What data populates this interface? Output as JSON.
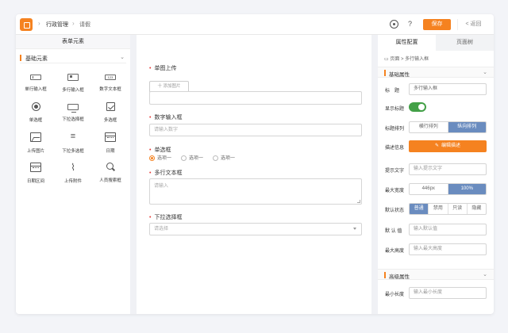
{
  "header": {
    "breadcrumb": [
      "行政管理",
      "请假"
    ],
    "save_label": "保存",
    "back_label": "< 返回",
    "settings_icon": "gear-icon",
    "help_text": "?"
  },
  "left_panel": {
    "title": "表单元素",
    "group_title": "基础元素",
    "components": [
      {
        "label": "单行输入框",
        "icon": "input-icon"
      },
      {
        "label": "多行输入框",
        "icon": "textarea-icon"
      },
      {
        "label": "数字文本框",
        "icon": "number-icon"
      },
      {
        "label": "单选框",
        "icon": "radio-icon"
      },
      {
        "label": "下拉选择框",
        "icon": "select-icon"
      },
      {
        "label": "多选框",
        "icon": "checkbox-icon"
      },
      {
        "label": "上传图片",
        "icon": "image-icon"
      },
      {
        "label": "下拉多选框",
        "icon": "multi-select-icon"
      },
      {
        "label": "日期",
        "icon": "calendar-icon"
      },
      {
        "label": "日期区间",
        "icon": "date-range-icon"
      },
      {
        "label": "上传附件",
        "icon": "paperclip-icon"
      },
      {
        "label": "人员搜索框",
        "icon": "search-icon"
      }
    ],
    "number_icon_text": "123"
  },
  "canvas": {
    "image_upload": {
      "label": "单图上传",
      "button": "十 添加图片"
    },
    "number_field": {
      "label": "数字输入框",
      "placeholder": "请输入数字"
    },
    "radio_field": {
      "label": "单选框",
      "options": [
        "选项一",
        "选项一",
        "选项一"
      ]
    },
    "textarea_field": {
      "label": "多行文本框",
      "placeholder": "请输入"
    },
    "select_field": {
      "label": "下拉选择框",
      "placeholder": "请选择"
    }
  },
  "right_panel": {
    "tabs": [
      "属性配置",
      "页面树"
    ],
    "breadcrumb": "页面 > 多行输入框",
    "basic_section": "基础属性",
    "advanced_section": "高级属性",
    "props": {
      "title_label": "标　题",
      "title_value": "多行输入框",
      "show_title_label": "显示标题",
      "title_layout_label": "标题排列",
      "title_layout_options": [
        "横行排列",
        "纵向排列"
      ],
      "desc_label": "描述信息",
      "edit_desc_button": "编辑描述",
      "hint_label": "提示文字",
      "hint_placeholder": "输入提示文字",
      "max_width_label": "最大宽度",
      "max_width_options": [
        "446px",
        "100%"
      ],
      "default_state_label": "默认状态",
      "state_options": [
        "普通",
        "禁用",
        "只读",
        "隐藏"
      ],
      "default_value_label": "默 认 值",
      "default_value_placeholder": "输入默认值",
      "max_height_label": "最大高度",
      "max_height_placeholder": "输入最大高度",
      "min_length_label": "最小长度",
      "min_length_placeholder": "输入最小长度"
    }
  },
  "colors": {
    "accent": "#f58220",
    "toggle_on": "#43a047",
    "segment_on": "#6a8cbf"
  }
}
